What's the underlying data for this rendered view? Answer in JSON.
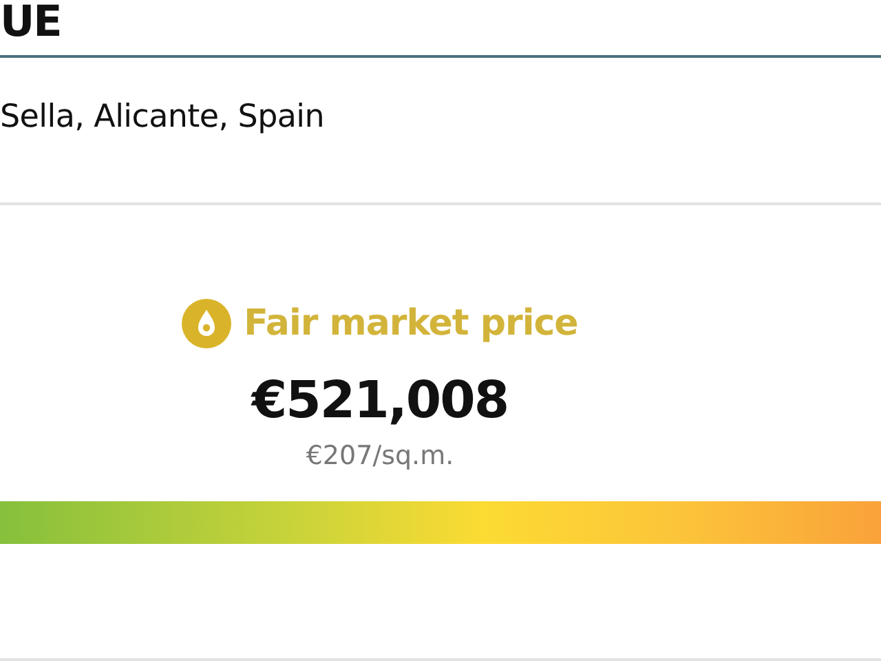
{
  "heading": "UE",
  "address": "Sella, Alicante, Spain",
  "valuation": {
    "rating": "Fair market price",
    "price": "€521,008",
    "price_per_area": "€207/sq.m."
  }
}
